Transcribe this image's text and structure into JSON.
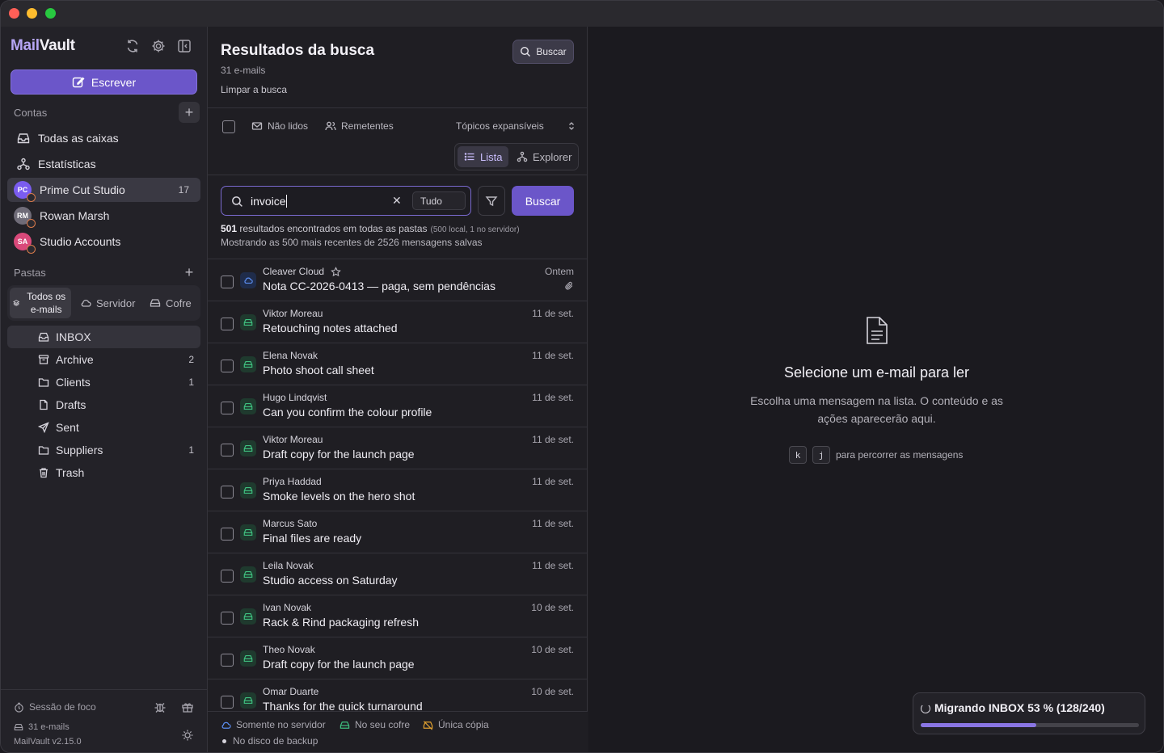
{
  "app": {
    "name_prefix": "Mail",
    "name_suffix": "Vault",
    "version": "MailVault v2.15.0"
  },
  "sidebar": {
    "compose_label": "Escrever",
    "accounts_label": "Contas",
    "nav": [
      {
        "label": "Todas as caixas",
        "icon": "inbox-stack-icon"
      },
      {
        "label": "Estatísticas",
        "icon": "stats-icon"
      }
    ],
    "accounts": [
      {
        "initials": "PC",
        "label": "Prime Cut Studio",
        "count": "17",
        "color": "#7a5cf0",
        "active": true
      },
      {
        "initials": "RM",
        "label": "Rowan Marsh",
        "count": "",
        "color": "#6f6c78",
        "active": false
      },
      {
        "initials": "SA",
        "label": "Studio Accounts",
        "count": "",
        "color": "#d9497a",
        "active": false
      }
    ],
    "folders_label": "Pastas",
    "segments": [
      "Todos os e-mails",
      "Servidor",
      "Cofre"
    ],
    "folders": [
      {
        "label": "INBOX",
        "count": "",
        "icon": "inbox-icon",
        "active": true
      },
      {
        "label": "Archive",
        "count": "2",
        "icon": "archive-icon",
        "active": false
      },
      {
        "label": "Clients",
        "count": "1",
        "icon": "folder-icon",
        "active": false
      },
      {
        "label": "Drafts",
        "count": "",
        "icon": "draft-icon",
        "active": false
      },
      {
        "label": "Sent",
        "count": "",
        "icon": "send-icon",
        "active": false
      },
      {
        "label": "Suppliers",
        "count": "1",
        "icon": "folder-icon",
        "active": false
      },
      {
        "label": "Trash",
        "count": "",
        "icon": "trash-icon",
        "active": false
      }
    ],
    "focus_session": "Sessão de foco",
    "email_count": "31 e-mails"
  },
  "list": {
    "title": "Resultados da busca",
    "subtitle": "31 e-mails",
    "clear_label": "Limpar a busca",
    "top_search_button": "Buscar",
    "filter_unread": "Não lidos",
    "filter_senders": "Remetentes",
    "threads_label": "Tópicos expansíveis",
    "view_list": "Lista",
    "view_explorer": "Explorer",
    "search": {
      "query": "invoice",
      "scope": "Tudo",
      "button": "Buscar"
    },
    "result_count": "501",
    "result_text": " resultados encontrados em todas as pastas",
    "result_detail": "(500 local, 1 no servidor)",
    "result_line2": "Mostrando as 500 mais recentes de 2526 mensagens salvas",
    "messages": [
      {
        "sender": "Cleaver Cloud",
        "subject": "Nota CC-2026-0413 — paga, sem pendências",
        "date": "Ontem",
        "location": "cloud",
        "starred": true,
        "attachment": true
      },
      {
        "sender": "Viktor Moreau",
        "subject": "Retouching notes attached",
        "date": "11 de set.",
        "location": "vault"
      },
      {
        "sender": "Elena Novak",
        "subject": "Photo shoot call sheet",
        "date": "11 de set.",
        "location": "vault"
      },
      {
        "sender": "Hugo Lindqvist",
        "subject": "Can you confirm the colour profile",
        "date": "11 de set.",
        "location": "vault"
      },
      {
        "sender": "Viktor Moreau",
        "subject": "Draft copy for the launch page",
        "date": "11 de set.",
        "location": "vault"
      },
      {
        "sender": "Priya Haddad",
        "subject": "Smoke levels on the hero shot",
        "date": "11 de set.",
        "location": "vault"
      },
      {
        "sender": "Marcus Sato",
        "subject": "Final files are ready",
        "date": "11 de set.",
        "location": "vault"
      },
      {
        "sender": "Leila Novak",
        "subject": "Studio access on Saturday",
        "date": "11 de set.",
        "location": "vault"
      },
      {
        "sender": "Ivan Novak",
        "subject": "Rack & Rind packaging refresh",
        "date": "10 de set.",
        "location": "vault"
      },
      {
        "sender": "Theo Novak",
        "subject": "Draft copy for the launch page",
        "date": "10 de set.",
        "location": "vault"
      },
      {
        "sender": "Omar Duarte",
        "subject": "Thanks for the quick turnaround",
        "date": "10 de set.",
        "location": "vault"
      }
    ],
    "legend": [
      "Somente no servidor",
      "No seu cofre",
      "Única cópia",
      "No disco de backup"
    ]
  },
  "reader": {
    "empty_title": "Selecione um e-mail para ler",
    "empty_desc": "Escolha uma mensagem na lista. O conteúdo e as ações aparecerão aqui.",
    "key_k": "k",
    "key_j": "j",
    "keys_hint": "para percorrer as mensagens"
  },
  "migration": {
    "text": "Migrando INBOX 53 % (128/240)",
    "progress": 0.53
  },
  "colors": {
    "accent": "#6b56c9",
    "vault_green": "#3fbf7f",
    "cloud_blue": "#5b8def",
    "unique_orange": "#e0a030"
  }
}
